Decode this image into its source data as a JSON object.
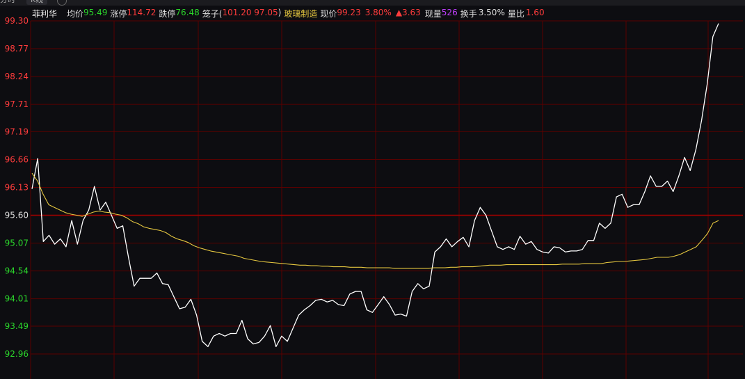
{
  "tabs": {
    "time": "分时",
    "k": "K线"
  },
  "info": {
    "stock_name": "菲利华",
    "avg_label": "均价",
    "avg_value": "95.49",
    "limit_up_label": "涨停",
    "limit_up_value": "114.72",
    "limit_down_label": "跌停",
    "limit_down_value": "76.48",
    "cage_label": "笼子(",
    "cage_values": "101.20 97.05",
    "cage_close": ")",
    "industry": "玻璃制造",
    "price_label": "现价",
    "price_value": "99.23",
    "change_pct": "3.80%",
    "change_amt": "▲3.63",
    "volume_label": "现量",
    "volume_value": "526",
    "turnover_label": "换手",
    "turnover_value": "3.50%",
    "volume_ratio_label": "量比",
    "volume_ratio_value": "1.60"
  },
  "colors": {
    "up": "#ff3c3c",
    "down": "#2bd62b",
    "grid": "#5a0000",
    "price_line": "#ffffff",
    "avg_line": "#e6c840",
    "industry": "#e6c840",
    "volume": "#c040ff",
    "text": "#cccccc"
  },
  "chart_data": {
    "type": "line",
    "title": "",
    "xlabel": "",
    "ylabel": "",
    "grid": true,
    "ylim": [
      92.96,
      99.3
    ],
    "y_ticks": [
      "99.30",
      "98.77",
      "98.24",
      "97.71",
      "97.19",
      "96.66",
      "96.13",
      "95.60",
      "95.07",
      "94.54",
      "94.01",
      "93.49",
      "92.96"
    ],
    "reference_price": 95.6,
    "series": [
      {
        "role": "price",
        "values": [
          96.1,
          96.68,
          95.1,
          95.22,
          95.05,
          95.15,
          95.0,
          95.5,
          95.05,
          95.5,
          95.7,
          96.15,
          95.7,
          95.85,
          95.6,
          95.35,
          95.4,
          94.8,
          94.25,
          94.4,
          94.4,
          94.4,
          94.5,
          94.3,
          94.28,
          94.05,
          93.82,
          93.85,
          94.0,
          93.7,
          93.2,
          93.1,
          93.3,
          93.35,
          93.3,
          93.35,
          93.35,
          93.6,
          93.25,
          93.15,
          93.18,
          93.3,
          93.5,
          93.1,
          93.3,
          93.2,
          93.45,
          93.7,
          93.8,
          93.88,
          93.98,
          94.0,
          93.95,
          93.98,
          93.9,
          93.88,
          94.1,
          94.15,
          94.15,
          93.8,
          93.75,
          93.9,
          94.05,
          93.9,
          93.7,
          93.72,
          93.68,
          94.15,
          94.3,
          94.2,
          94.25,
          94.9,
          95.0,
          95.15,
          95.0,
          95.1,
          95.18,
          95.0,
          95.5,
          95.75,
          95.6,
          95.3,
          95.0,
          94.95,
          95.0,
          94.95,
          95.2,
          95.05,
          95.1,
          94.95,
          94.9,
          94.88,
          95.0,
          94.98,
          94.9,
          94.92,
          94.92,
          94.95,
          95.12,
          95.12,
          95.45,
          95.35,
          95.45,
          95.95,
          96.0,
          95.75,
          95.8,
          95.8,
          96.05,
          96.35,
          96.15,
          96.15,
          96.25,
          96.05,
          96.35,
          96.7,
          96.45,
          96.85,
          97.4,
          98.1,
          99.0,
          99.25
        ]
      },
      {
        "role": "average",
        "values": [
          96.4,
          96.25,
          96.0,
          95.8,
          95.75,
          95.7,
          95.65,
          95.62,
          95.6,
          95.58,
          95.62,
          95.66,
          95.68,
          95.66,
          95.65,
          95.62,
          95.6,
          95.55,
          95.48,
          95.44,
          95.38,
          95.35,
          95.33,
          95.31,
          95.27,
          95.2,
          95.15,
          95.12,
          95.08,
          95.02,
          94.98,
          94.95,
          94.92,
          94.9,
          94.88,
          94.86,
          94.84,
          94.82,
          94.78,
          94.76,
          94.74,
          94.72,
          94.71,
          94.7,
          94.69,
          94.68,
          94.67,
          94.66,
          94.65,
          94.65,
          94.64,
          94.64,
          94.63,
          94.63,
          94.62,
          94.62,
          94.62,
          94.61,
          94.61,
          94.61,
          94.6,
          94.6,
          94.6,
          94.6,
          94.6,
          94.59,
          94.59,
          94.59,
          94.59,
          94.59,
          94.59,
          94.59,
          94.6,
          94.6,
          94.6,
          94.61,
          94.61,
          94.62,
          94.62,
          94.62,
          94.63,
          94.64,
          94.65,
          94.65,
          94.65,
          94.66,
          94.66,
          94.66,
          94.66,
          94.66,
          94.66,
          94.66,
          94.66,
          94.66,
          94.66,
          94.67,
          94.67,
          94.67,
          94.67,
          94.68,
          94.68,
          94.68,
          94.68,
          94.7,
          94.71,
          94.72,
          94.72,
          94.73,
          94.74,
          94.75,
          94.76,
          94.78,
          94.8,
          94.8,
          94.8,
          94.82,
          94.85,
          94.9,
          94.95,
          95.0,
          95.12,
          95.25,
          95.45,
          95.5
        ]
      }
    ]
  }
}
